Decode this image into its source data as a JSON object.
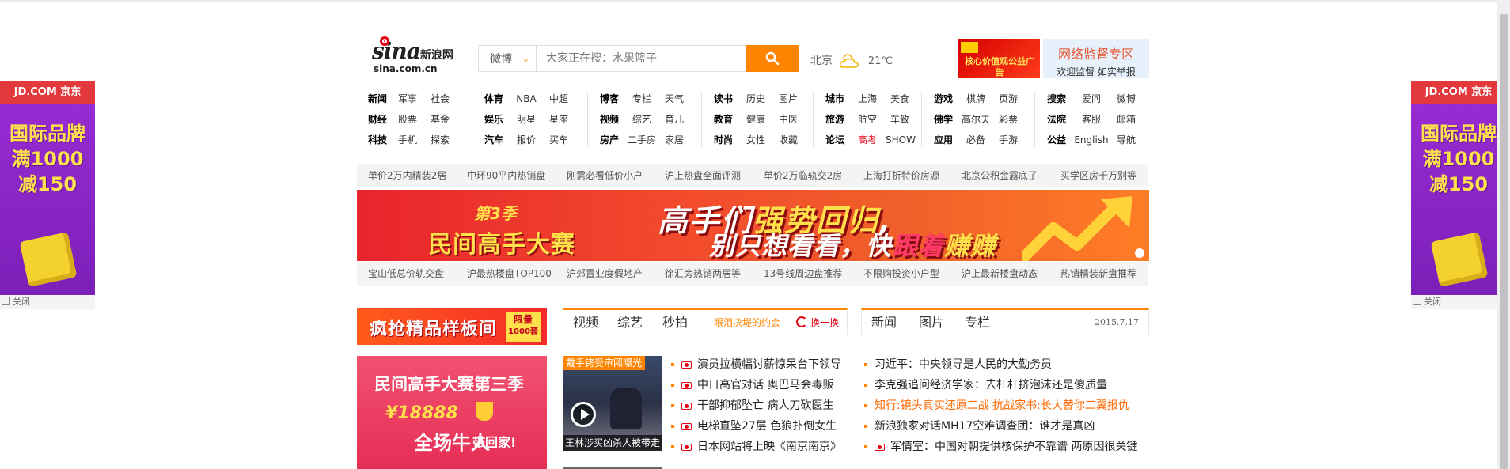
{
  "side_ads": {
    "brand": "JD.COM 京东",
    "line1": "国际品牌",
    "line2": "满1000",
    "line3": "减150",
    "close_label": "关闭"
  },
  "header": {
    "logo_text": "sina新浪网",
    "logo_brand": "sina",
    "logo_cn": "新浪网",
    "logo_url": "sina.com.cn",
    "search": {
      "scope": "微博",
      "placeholder": "大家正在搜：水果篮子"
    },
    "weather": {
      "city": "北京",
      "temp": "21℃"
    },
    "promo1": "核心价值观公益广告",
    "promo2": {
      "title": "网络监督专区",
      "sub": "欢迎监督 如实举报"
    }
  },
  "nav": {
    "columns": [
      [
        [
          "新闻",
          "军事",
          "社会"
        ],
        [
          "财经",
          "股票",
          "基金"
        ],
        [
          "科技",
          "手机",
          "探索"
        ]
      ],
      [
        [
          "体育",
          "NBA",
          "中超"
        ],
        [
          "娱乐",
          "明星",
          "星座"
        ],
        [
          "汽车",
          "报价",
          "买车"
        ]
      ],
      [
        [
          "博客",
          "专栏",
          "天气"
        ],
        [
          "视频",
          "综艺",
          "育儿"
        ],
        [
          "房产",
          "二手房",
          "家居"
        ]
      ],
      [
        [
          "读书",
          "历史",
          "图片"
        ],
        [
          "教育",
          "健康",
          "中医"
        ],
        [
          "时尚",
          "女性",
          "收藏"
        ]
      ],
      [
        [
          "城市",
          "上海",
          "美食"
        ],
        [
          "旅游",
          "航空",
          "车致"
        ],
        [
          "论坛",
          "高考",
          "SHOW"
        ]
      ],
      [
        [
          "游戏",
          "棋牌",
          "页游"
        ],
        [
          "佛学",
          "高尔夫",
          "彩票"
        ],
        [
          "应用",
          "必备",
          "手游"
        ]
      ],
      [
        [
          "搜索",
          "爱问",
          "微博"
        ],
        [
          "法院",
          "客服",
          "邮箱"
        ],
        [
          "公益",
          "English",
          "导航"
        ]
      ]
    ]
  },
  "house_links_1": [
    "单价2万内精装2居",
    "中环90平内热销盘",
    "刚需必看低价小户",
    "沪上热盘全面评测",
    "单价2万临轨交2房",
    "上海打折特价房源",
    "北京公积金露底了",
    "买学区房千万别等"
  ],
  "house_links_2": [
    "宝山低总价轨交盘",
    "沪最热楼盘TOP100",
    "沪郊置业度假地产",
    "徐汇旁热销两居等",
    "13号线周边盘推荐",
    "不限购投资小户型",
    "沪上最新楼盘动态",
    "热销精装新盘推荐"
  ],
  "banner": {
    "season": "第3季",
    "title": "民间高手大赛",
    "slogan1_a": "高手们",
    "slogan1_b": "强势回归",
    "slogan1_c": ",",
    "slogan2_a": "别只想看看，快",
    "slogan2_b": "跟着",
    "slogan2_c": "赚赚"
  },
  "left_ads": {
    "showroom": "疯抢精品样板间",
    "showroom_tag_1": "限量",
    "showroom_tag_2": "1000套",
    "contest_title": "民间高手大赛第三季",
    "contest_prize": "¥18888",
    "contest_cta": "全场牛人",
    "contest_cta2": "带回家!"
  },
  "video": {
    "tabs": [
      "视频",
      "综艺",
      "秒拍"
    ],
    "extra": "眼泪决堤的约会",
    "refresh": "换一换",
    "thumb_top": "戴手铐受审照曝光",
    "thumb_bottom": "王林涉买凶杀人被带走",
    "items": [
      "演员拉横幅讨薪惊呆台下领导",
      "中日高官对话 奥巴马会毒贩",
      "干部抑郁坠亡 病人刀砍医生",
      "电梯直坠27层 色狼扑倒女生",
      "日本网站将上映《南京南京》"
    ]
  },
  "news": {
    "tabs": [
      "新闻",
      "图片",
      "专栏"
    ],
    "date": "2015.7.17",
    "items": [
      {
        "text": "习近平：中央领导是人民的大勤务员",
        "style": "dark",
        "video": false
      },
      {
        "text": "李克强追问经济学家：去杠杆挤泡沫还是傻质量",
        "style": "dark",
        "video": false
      },
      {
        "text": "知行:镜头真实还原二战 抗战家书:长大替你二翼报仇",
        "style": "orange",
        "video": false
      },
      {
        "text": "新浪独家对话MH17空难调查团：谁才是真凶",
        "style": "dark",
        "video": false
      },
      {
        "text": "军情室：中国对朝提供核保护不靠谱 两原因很关键",
        "style": "dark",
        "video": true
      }
    ]
  }
}
